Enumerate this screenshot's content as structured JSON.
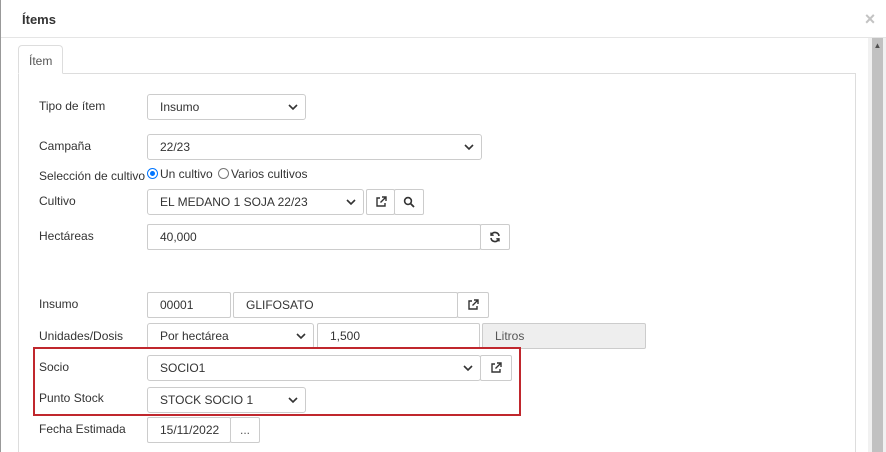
{
  "modal": {
    "title": "Ítems",
    "close_glyph": "×"
  },
  "tabs": [
    {
      "label": "Ítem"
    }
  ],
  "form": {
    "tipo_item": {
      "label": "Tipo de ítem",
      "value": "Insumo"
    },
    "campana": {
      "label": "Campaña",
      "value": "22/23"
    },
    "seleccion_cultivo": {
      "label": "Selección de cultivo",
      "options": [
        "Un cultivo",
        "Varios cultivos"
      ],
      "selected": "Un cultivo"
    },
    "cultivo": {
      "label": "Cultivo",
      "value": "EL MEDANO 1 SOJA 22/23"
    },
    "hectareas": {
      "label": "Hectáreas",
      "value": "40,000"
    },
    "insumo": {
      "label": "Insumo",
      "code": "00001",
      "name": "GLIFOSATO"
    },
    "unidades_dosis": {
      "label": "Unidades/Dosis",
      "mode": "Por hectárea",
      "amount": "1,500",
      "unit": "Litros"
    },
    "socio": {
      "label": "Socio",
      "value": "SOCIO1"
    },
    "punto_stock": {
      "label": "Punto Stock",
      "value": "STOCK SOCIO 1"
    },
    "fecha_estimada": {
      "label": "Fecha Estimada",
      "value": "15/11/2022",
      "picker_label": "..."
    }
  },
  "icons": {
    "external_link": "external-link-icon",
    "search": "search-icon",
    "refresh": "refresh-icon",
    "chevron": "chevron-down-icon"
  },
  "colors": {
    "highlight": "#c0272d",
    "radio_accent": "#0075ff"
  }
}
